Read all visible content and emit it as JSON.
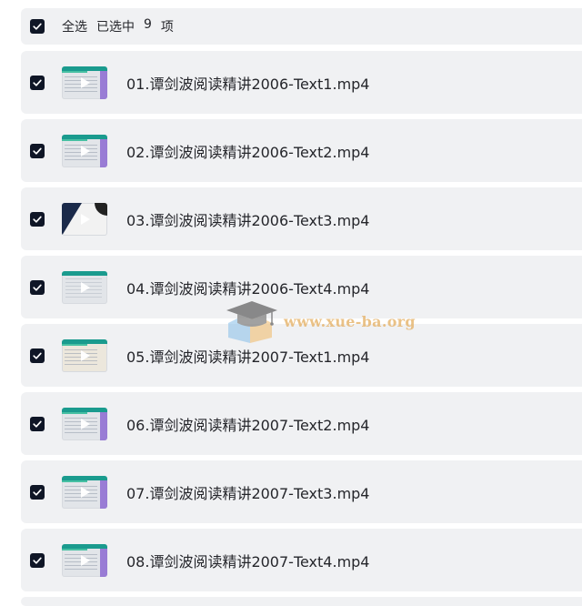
{
  "header": {
    "select_all_label": "全选",
    "selected_text": "已选中",
    "selected_count": "9",
    "count_unit": "项",
    "checked": true
  },
  "files": [
    {
      "name": "01.谭剑波阅读精讲2006-Text1.mp4",
      "checked": true,
      "thumb_style": "slide"
    },
    {
      "name": "02.谭剑波阅读精讲2006-Text2.mp4",
      "checked": true,
      "thumb_style": "slide"
    },
    {
      "name": "03.谭剑波阅读精讲2006-Text3.mp4",
      "checked": true,
      "thumb_style": "dark"
    },
    {
      "name": "04.谭剑波阅读精讲2006-Text4.mp4",
      "checked": true,
      "thumb_style": "plain"
    },
    {
      "name": "05.谭剑波阅读精讲2007-Text1.mp4",
      "checked": true,
      "thumb_style": "beige"
    },
    {
      "name": "06.谭剑波阅读精讲2007-Text2.mp4",
      "checked": true,
      "thumb_style": "slide"
    },
    {
      "name": "07.谭剑波阅读精讲2007-Text3.mp4",
      "checked": true,
      "thumb_style": "slide"
    },
    {
      "name": "08.谭剑波阅读精讲2007-Text4.mp4",
      "checked": true,
      "thumb_style": "slide"
    }
  ],
  "watermark": {
    "text": "www.xue-ba.org"
  },
  "colors": {
    "row_background": "#f0f1f3",
    "checkbox_fill": "#0f1626",
    "text": "#25262b",
    "watermark": "#e6b36a"
  }
}
